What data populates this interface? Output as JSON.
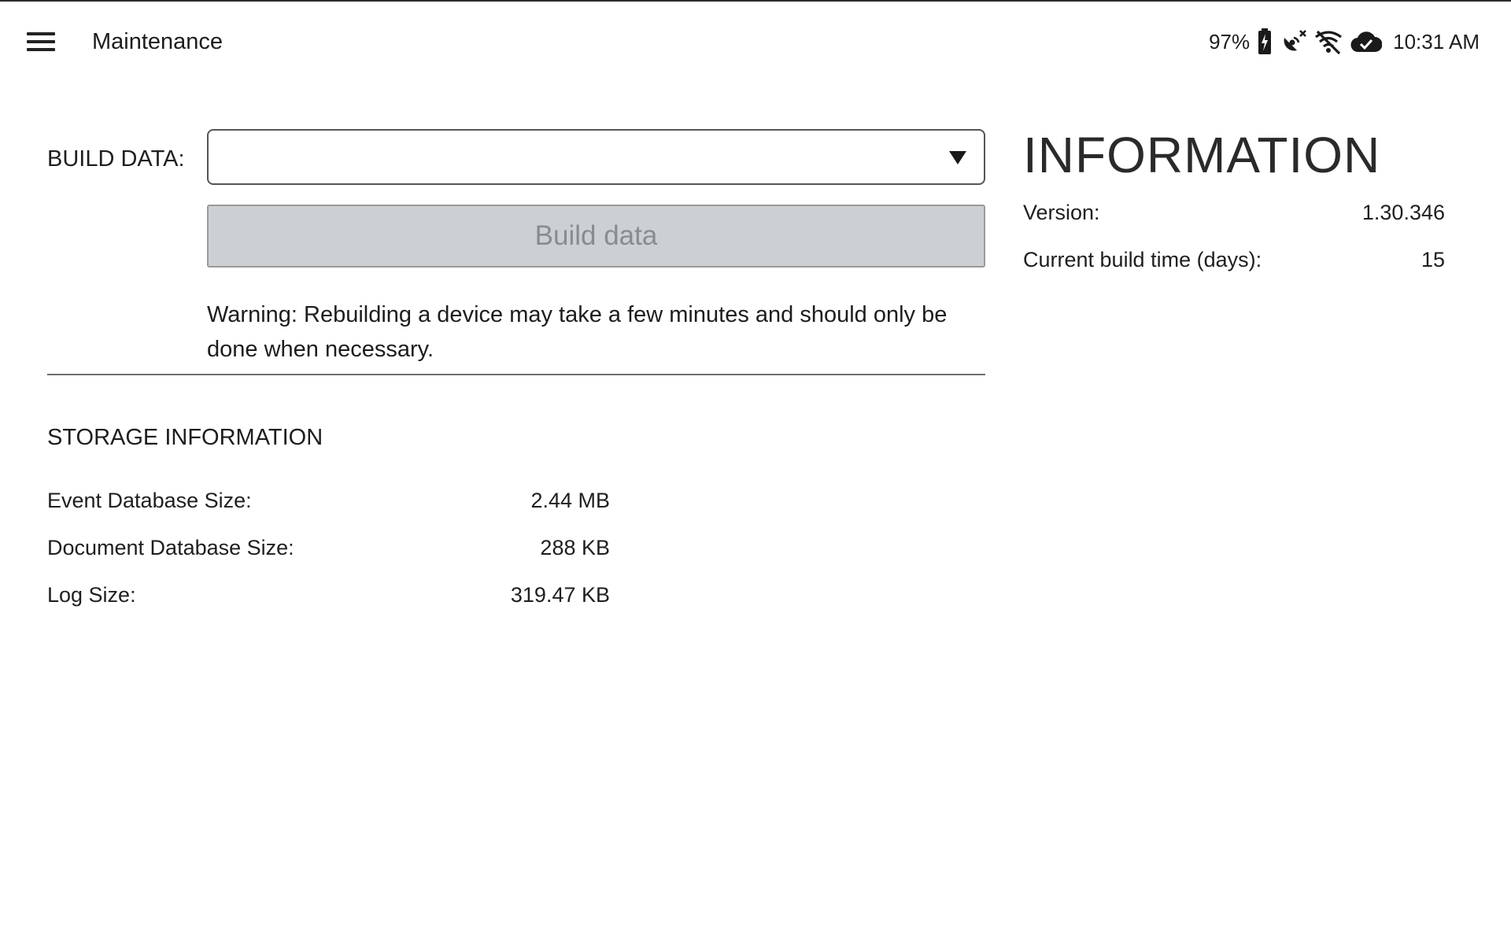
{
  "header": {
    "title": "Maintenance",
    "battery": "97%",
    "time": "10:31 AM",
    "icons": [
      "menu-icon",
      "battery-charging-icon",
      "satellite-off-icon",
      "wifi-off-icon",
      "cloud-done-icon"
    ]
  },
  "build": {
    "label": "BUILD DATA:",
    "selected_value": "",
    "button_label": "Build data",
    "warning": "Warning: Rebuilding a device may take a few minutes and should only be done when necessary."
  },
  "storage": {
    "title": "STORAGE INFORMATION",
    "rows": [
      {
        "label": "Event Database Size:",
        "value": "2.44 MB"
      },
      {
        "label": "Document Database Size:",
        "value": "288 KB"
      },
      {
        "label": "Log Size:",
        "value": "319.47 KB"
      }
    ]
  },
  "information": {
    "title": "INFORMATION",
    "rows": [
      {
        "label": "Version:",
        "value": "1.30.346"
      },
      {
        "label": "Current build time (days):",
        "value": "15"
      }
    ]
  },
  "colors": {
    "button_bg": "#cdd0d3",
    "button_text": "#888c90",
    "text": "#1d1d1d"
  }
}
